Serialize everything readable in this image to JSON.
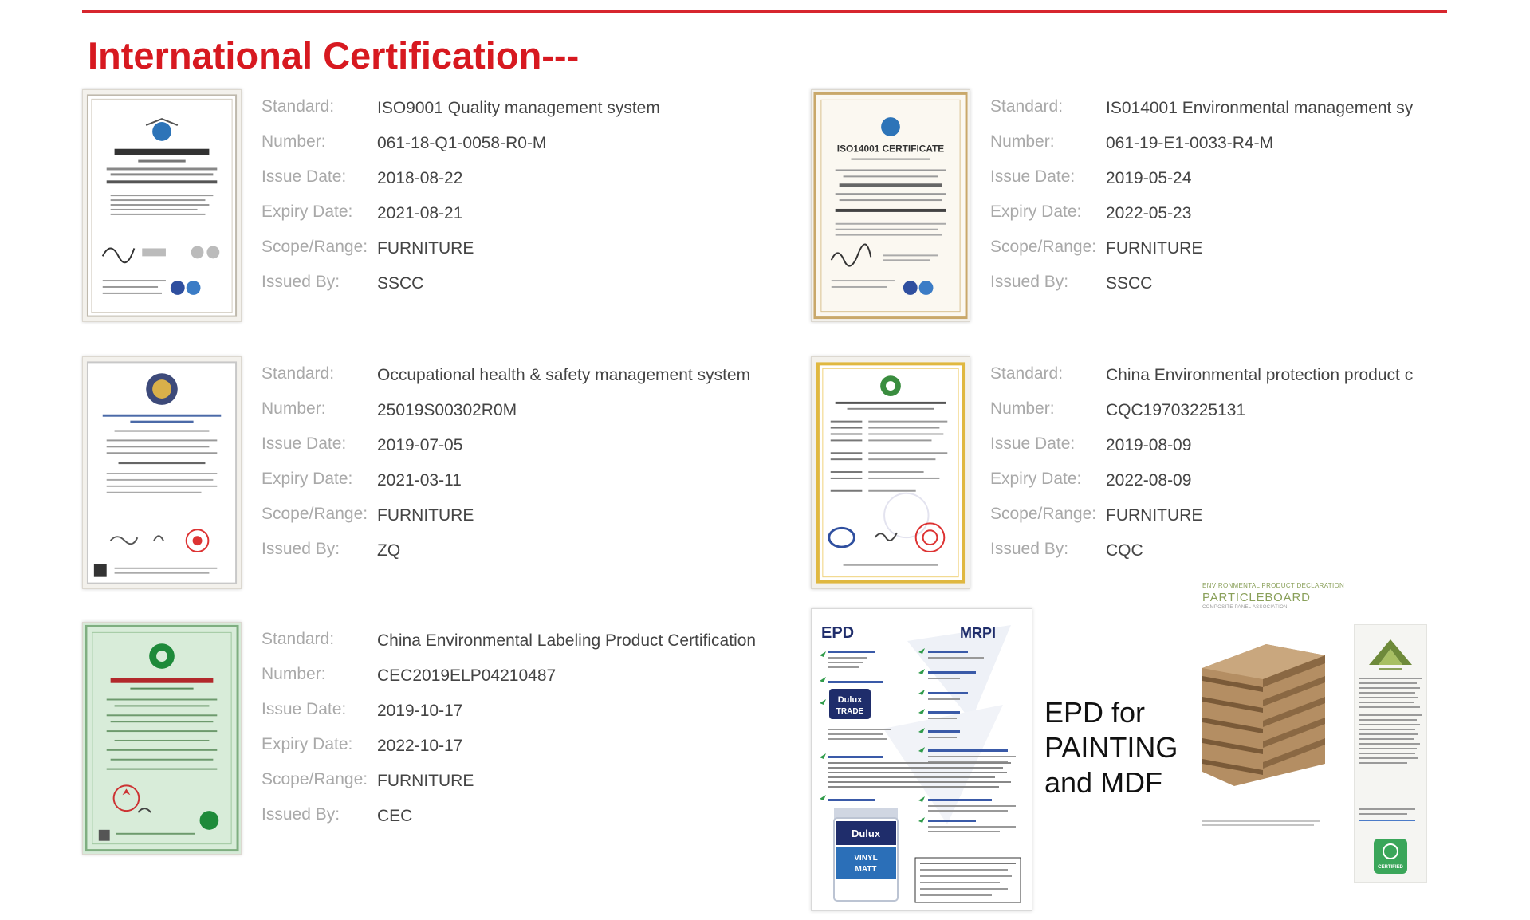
{
  "title": "International Certification---",
  "labels": {
    "standard": "Standard:",
    "number": "Number:",
    "issue_date": "Issue Date:",
    "expiry_date": "Expiry Date:",
    "scope": "Scope/Range:",
    "issued_by": "Issued By:"
  },
  "certificates": [
    {
      "standard": "ISO9001 Quality management system",
      "number": "061-18-Q1-0058-R0-M",
      "issue_date": "2018-08-22",
      "expiry_date": "2021-08-21",
      "scope": "FURNITURE",
      "issued_by": "SSCC"
    },
    {
      "standard": "IS014001 Environmental management sy",
      "number": "061-19-E1-0033-R4-M",
      "issue_date": "2019-05-24",
      "expiry_date": "2022-05-23",
      "scope": "FURNITURE",
      "issued_by": "SSCC"
    },
    {
      "standard": "Occupational health & safety management system",
      "number": "25019S00302R0M",
      "issue_date": "2019-07-05",
      "expiry_date": "2021-03-11",
      "scope": "FURNITURE",
      "issued_by": "ZQ"
    },
    {
      "standard": "China Environmental protection product c",
      "number": "CQC19703225131",
      "issue_date": "2019-08-09",
      "expiry_date": "2022-08-09",
      "scope": "FURNITURE",
      "issued_by": "CQC"
    },
    {
      "standard": "China Environmental Labeling Product Certification",
      "number": "CEC2019ELP04210487",
      "issue_date": "2019-10-17",
      "expiry_date": "2022-10-17",
      "scope": "FURNITURE",
      "issued_by": "CEC"
    }
  ],
  "thumbnail_text": {
    "iso14001": "ISO14001 CERTIFICATE"
  },
  "epd": {
    "caption_lines": [
      "EPD for",
      "PAINTING",
      "and MDF"
    ],
    "doc_logo_left": "EPD",
    "doc_logo_right": "MRPI",
    "brand_line1": "Dulux",
    "brand_line2": "TRADE",
    "can_label_line1": "VINYL",
    "can_label_line2": "MATT"
  },
  "particleboard": {
    "kicker": "ENVIRONMENTAL PRODUCT DECLARATION",
    "title": "PARTICLEBOARD",
    "subtitle": "COMPOSITE PANEL ASSOCIATION",
    "badge": "CERTIFIED"
  },
  "colors": {
    "accent_red": "#d71920",
    "label_gray": "#a9a9a9",
    "value_gray": "#444444"
  }
}
